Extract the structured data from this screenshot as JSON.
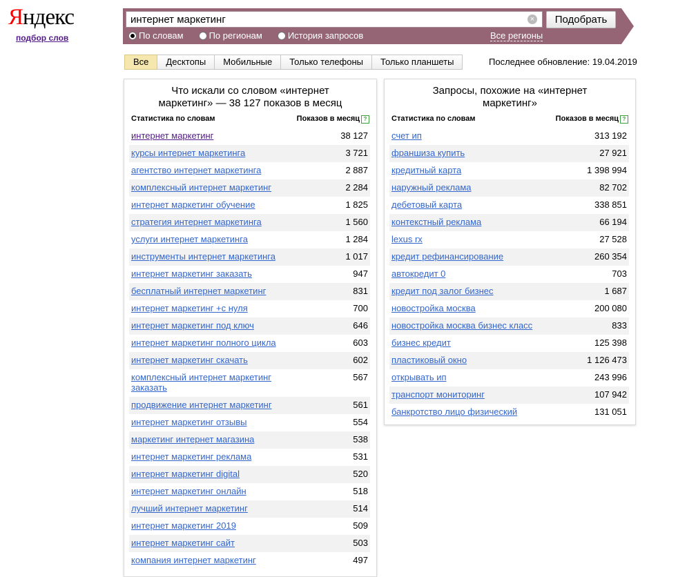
{
  "logo": {
    "first_letter": "Я",
    "rest": "ндекс"
  },
  "sublink": "подбор слов",
  "search": {
    "value": "интернет маркетинг",
    "clear": "×",
    "submit": "Подобрать"
  },
  "modes": [
    {
      "label": "По словам",
      "selected": true
    },
    {
      "label": "По регионам",
      "selected": false
    },
    {
      "label": "История запросов",
      "selected": false
    }
  ],
  "regions_link": "Все регионы",
  "tabs": [
    "Все",
    "Десктопы",
    "Мобильные",
    "Только телефоны",
    "Только планшеты"
  ],
  "active_tab": 0,
  "last_update": "Последнее обновление: 19.04.2019",
  "left_panel": {
    "title": "Что искали со словом «интернет маркетинг» — 38 127 показов в месяц",
    "col_phrase": "Статистика по словам",
    "col_count": "Показов в месяц",
    "help": "?",
    "rows": [
      {
        "phrase": "интернет маркетинг",
        "count": "38 127",
        "visited": true
      },
      {
        "phrase": "курсы интернет маркетинга",
        "count": "3 721"
      },
      {
        "phrase": "агентство интернет маркетинга",
        "count": "2 887"
      },
      {
        "phrase": "комплексный интернет маркетинг",
        "count": "2 284"
      },
      {
        "phrase": "интернет маркетинг обучение",
        "count": "1 825"
      },
      {
        "phrase": "стратегия интернет маркетинга",
        "count": "1 560"
      },
      {
        "phrase": "услуги интернет маркетинга",
        "count": "1 284"
      },
      {
        "phrase": "инструменты интернет маркетинга",
        "count": "1 017"
      },
      {
        "phrase": "интернет маркетинг заказать",
        "count": "947"
      },
      {
        "phrase": "бесплатный интернет маркетинг",
        "count": "831"
      },
      {
        "phrase": "интернет маркетинг +с нуля",
        "count": "700"
      },
      {
        "phrase": "интернет маркетинг под ключ",
        "count": "646"
      },
      {
        "phrase": "интернет маркетинг полного цикла",
        "count": "603"
      },
      {
        "phrase": "интернет маркетинг скачать",
        "count": "602"
      },
      {
        "phrase": "комплексный интернет маркетинг заказать",
        "count": "567",
        "tall": true
      },
      {
        "phrase": "продвижение интернет маркетинг",
        "count": "561"
      },
      {
        "phrase": "интернет маркетинг отзывы",
        "count": "554"
      },
      {
        "phrase": "маркетинг интернет магазина",
        "count": "538"
      },
      {
        "phrase": "интернет маркетинг реклама",
        "count": "531"
      },
      {
        "phrase": "интернет маркетинг digital",
        "count": "520"
      },
      {
        "phrase": "интернет маркетинг онлайн",
        "count": "518"
      },
      {
        "phrase": "лучший интернет маркетинг",
        "count": "514"
      },
      {
        "phrase": "интернет маркетинг 2019",
        "count": "509"
      },
      {
        "phrase": "интернет маркетинг сайт",
        "count": "503"
      },
      {
        "phrase": "компания интернет маркетинг",
        "count": "497"
      }
    ]
  },
  "right_panel": {
    "title": "Запросы, похожие на «интернет маркетинг»",
    "col_phrase": "Статистика по словам",
    "col_count": "Показов в месяц",
    "help": "?",
    "rows": [
      {
        "phrase": "счет ип",
        "count": "313 192"
      },
      {
        "phrase": "франшиза купить",
        "count": "27 921"
      },
      {
        "phrase": "кредитный карта",
        "count": "1 398 994"
      },
      {
        "phrase": "наружный реклама",
        "count": "82 702"
      },
      {
        "phrase": "дебетовый карта",
        "count": "338 851"
      },
      {
        "phrase": "контекстный реклама",
        "count": "66 194"
      },
      {
        "phrase": "lexus rx",
        "count": "27 528"
      },
      {
        "phrase": "кредит рефинансирование",
        "count": "260 354"
      },
      {
        "phrase": "автокредит 0",
        "count": "703"
      },
      {
        "phrase": "кредит под залог бизнес",
        "count": "1 687"
      },
      {
        "phrase": "новостройка москва",
        "count": "200 080"
      },
      {
        "phrase": "новостройка москва бизнес класс",
        "count": "833"
      },
      {
        "phrase": "бизнес кредит",
        "count": "125 398"
      },
      {
        "phrase": "пластиковый окно",
        "count": "1 126 473"
      },
      {
        "phrase": "открывать ип",
        "count": "243 996"
      },
      {
        "phrase": "транспорт мониторинг",
        "count": "107 942"
      },
      {
        "phrase": "банкротство лицо физический",
        "count": "131 051"
      }
    ]
  }
}
